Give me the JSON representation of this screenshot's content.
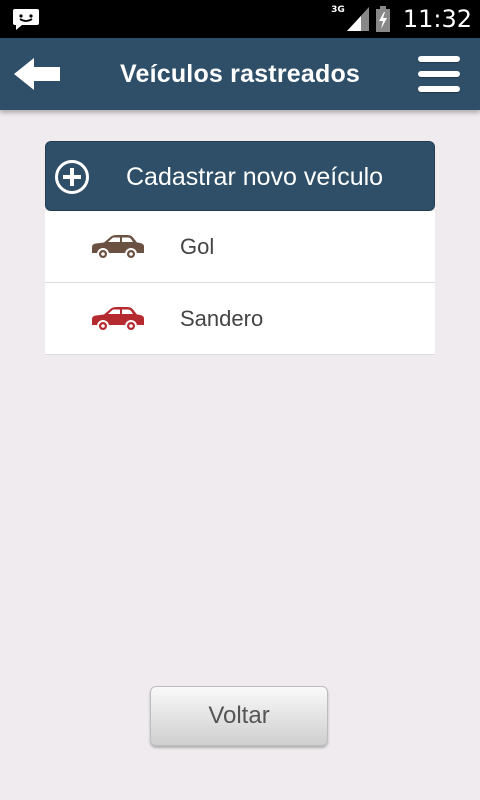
{
  "status_bar": {
    "time": "11:32",
    "network": "3G",
    "icons": [
      "message-icon",
      "signal-icon",
      "battery-icon"
    ]
  },
  "app_bar": {
    "title": "Veículos rastreados",
    "back_icon": "arrow-left-icon",
    "menu_icon": "hamburger-menu-icon",
    "color": "#2f4f69"
  },
  "add_vehicle": {
    "label": "Cadastrar novo veículo",
    "icon": "plus-circle-icon"
  },
  "vehicles": [
    {
      "name": "Gol",
      "icon": "car-icon",
      "color": "#6b5141"
    },
    {
      "name": "Sandero",
      "icon": "car-icon",
      "color": "#b52a2f"
    }
  ],
  "footer": {
    "back_label": "Voltar"
  }
}
